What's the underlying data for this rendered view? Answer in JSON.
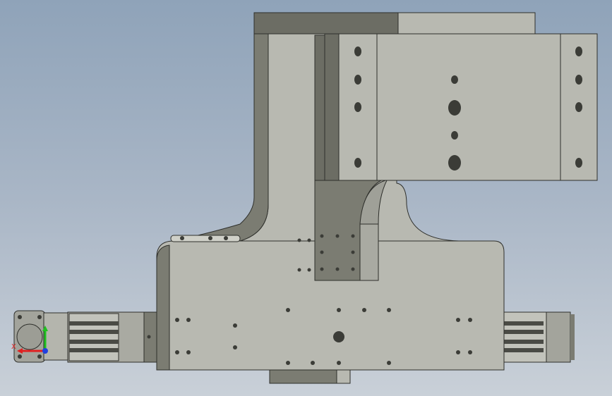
{
  "viewport": {
    "background_top": "#8fa3b9",
    "background_bottom": "#c9d0d8"
  },
  "part": {
    "face_color": "#b8b9b1",
    "shadow_color": "#7b7c72",
    "dark_color": "#5f6058",
    "edge_color": "#2e2f2b",
    "hole_color": "#3b3c37"
  },
  "triad": {
    "x_label": "X",
    "y_label": "",
    "z_label": "",
    "x_color": "#e02020",
    "y_color": "#20c020",
    "z_color": "#2040e0"
  }
}
